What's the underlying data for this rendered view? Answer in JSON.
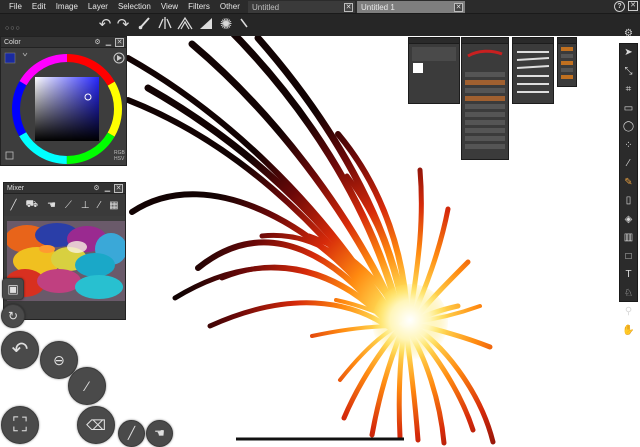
{
  "menu": {
    "items": [
      "File",
      "Edit",
      "Image",
      "Layer",
      "Selection",
      "View",
      "Filters",
      "Other"
    ]
  },
  "tabs": [
    {
      "label": "Untitled",
      "close": "✕"
    },
    {
      "label": "Untitled 1",
      "close": "✕"
    }
  ],
  "window": {
    "help": "?",
    "close": "✕",
    "settings": "⚙"
  },
  "toolbar": {
    "icons": [
      "undo-icon",
      "redo-icon",
      "brush-icon",
      "symmetry-icon",
      "perspective-icon",
      "ruler-icon",
      "sunburst-icon",
      "pen-icon"
    ],
    "dots": "○○○"
  },
  "color_panel": {
    "title": "Color",
    "mode_labels": [
      "RGB",
      "HSV"
    ],
    "current_color": "#1a2aa0",
    "hue_square_color": "#2626ff"
  },
  "mixer_panel": {
    "title": "Mixer",
    "tool_icons": [
      "brush-icon",
      "fill-bucket-icon",
      "smudge-icon",
      "knife-icon",
      "stamp-icon",
      "eyedropper-icon",
      "palette-icon"
    ]
  },
  "panel_controls": {
    "settings": "⚙",
    "minimize": "▁",
    "close": "✕"
  },
  "right_toolbar": {
    "tools": [
      "arrow-icon",
      "transform-icon",
      "crop-icon",
      "rect-select-icon",
      "lasso-icon",
      "wand-icon",
      "eyedropper-icon",
      "pencil-icon",
      "brush-icon",
      "fill-icon",
      "gradient-icon",
      "shape-icon",
      "text-icon",
      "clone-icon",
      "zoom-icon",
      "hand-icon"
    ]
  },
  "floating_buttons": [
    "layer-button",
    "rotate-button",
    "undo-button",
    "level-button",
    "eyedropper-button",
    "fullscreen-button",
    "eraser-button",
    "brush-button",
    "smudge-button"
  ],
  "colors": {
    "chrome": "#2b2b2b",
    "panel": "#3d3d3d",
    "canvas": "#ffffff",
    "stroke_dark": "#1a0505",
    "stroke_mid": "#c8280a",
    "stroke_bright": "#ffd000"
  }
}
